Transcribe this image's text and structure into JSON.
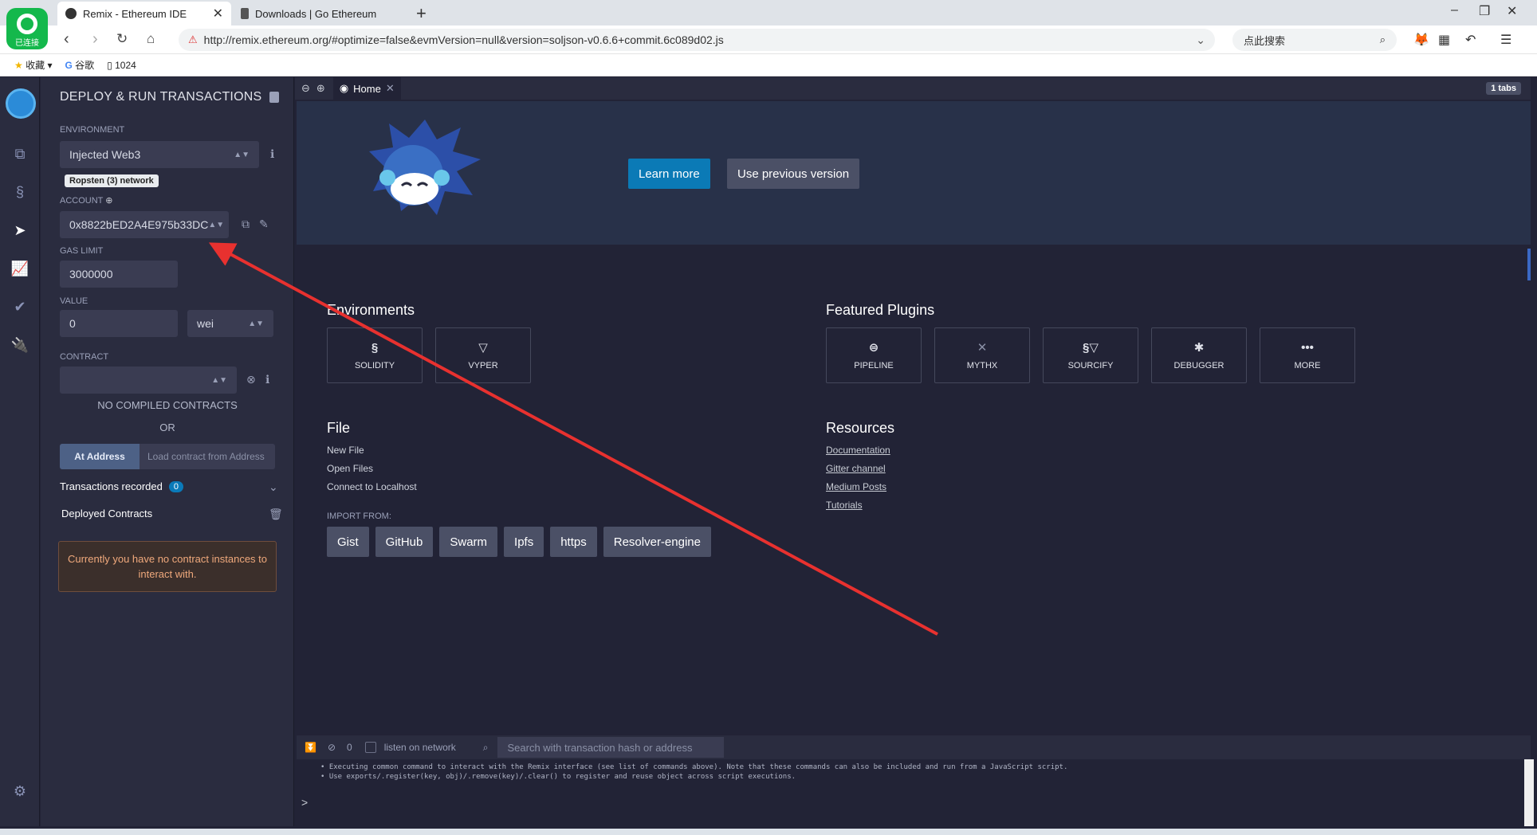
{
  "browser": {
    "connection_badge": "已连接",
    "tabs": [
      {
        "label": "Remix - Ethereum IDE"
      },
      {
        "label": "Downloads | Go Ethereum"
      }
    ],
    "url": "http://remix.ethereum.org/#optimize=false&evmVersion=null&version=soljson-v0.6.6+commit.6c089d02.js",
    "search_placeholder": "点此搜索",
    "bookmarks": [
      "收藏",
      "谷歌",
      "1024"
    ]
  },
  "panel": {
    "title": "DEPLOY & RUN TRANSACTIONS",
    "environment_label": "ENVIRONMENT",
    "environment_value": "Injected Web3",
    "network_pill": "Ropsten (3) network",
    "account_label": "ACCOUNT",
    "account_value": "0x8822bED2A4E975b33DC",
    "gas_limit_label": "GAS LIMIT",
    "gas_limit_value": "3000000",
    "value_label": "VALUE",
    "value_value": "0",
    "value_unit": "wei",
    "contract_label": "CONTRACT",
    "contract_value": "",
    "no_compiled": "NO COMPILED CONTRACTS",
    "or_text": "OR",
    "at_address_button": "At Address",
    "load_contract_placeholder": "Load contract from Address",
    "transactions_recorded": "Transactions recorded",
    "transactions_count": "0",
    "deployed_contracts": "Deployed Contracts",
    "no_instances_warning": "Currently you have no contract instances to interact with."
  },
  "main": {
    "home_tab": "Home",
    "tabs_count": "1 tabs",
    "learn_more": "Learn more",
    "use_previous": "Use previous version",
    "environments_title": "Environments",
    "environments": [
      {
        "label": "SOLIDITY",
        "icon": "solidity-icon"
      },
      {
        "label": "VYPER",
        "icon": "vyper-icon"
      }
    ],
    "featured_title": "Featured Plugins",
    "plugins": [
      {
        "label": "PIPELINE",
        "icon": "pipeline-icon"
      },
      {
        "label": "MYTHX",
        "icon": "mythx-icon"
      },
      {
        "label": "SOURCIFY",
        "icon": "sourcify-icon"
      },
      {
        "label": "DEBUGGER",
        "icon": "debugger-icon"
      },
      {
        "label": "MORE",
        "icon": "more-icon"
      }
    ],
    "file_title": "File",
    "file_links": [
      "New File",
      "Open Files",
      "Connect to Localhost"
    ],
    "import_from": "IMPORT FROM:",
    "import_buttons": [
      "Gist",
      "GitHub",
      "Swarm",
      "Ipfs",
      "https",
      "Resolver-engine"
    ],
    "resources_title": "Resources",
    "resource_links": [
      "Documentation",
      "Gitter channel",
      "Medium Posts",
      "Tutorials"
    ]
  },
  "terminal": {
    "count": "0",
    "listen_label": "listen on network",
    "search_placeholder": "Search with transaction hash or address",
    "lines": [
      "• Executing common command to interact with the Remix interface (see list of commands above). Note that these commands can also be included and run from a JavaScript script.",
      "• Use exports/.register(key, obj)/.remove(key)/.clear() to register and reuse object across script executions."
    ],
    "prompt": ">"
  },
  "colors": {
    "accent": "#0b7ab6",
    "background": "#222336",
    "panel": "#2a2c3f",
    "arrow": "#e8312f"
  }
}
